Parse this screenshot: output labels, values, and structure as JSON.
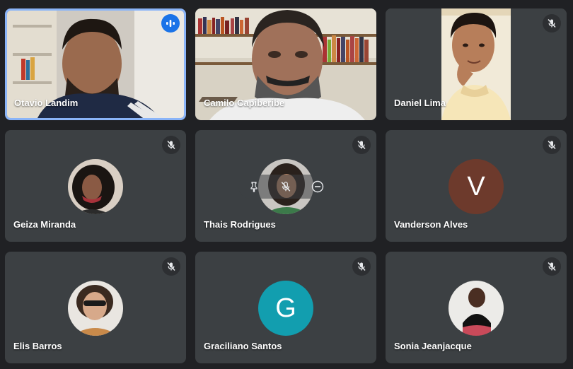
{
  "participants": [
    {
      "name": "Otavio Landim",
      "state": "speaking"
    },
    {
      "name": "Camilo Capiberibe",
      "state": "video"
    },
    {
      "name": "Daniel Lima",
      "state": "muted"
    },
    {
      "name": "Geiza Miranda",
      "state": "muted"
    },
    {
      "name": "Thais Rodrigues",
      "state": "muted"
    },
    {
      "name": "Vanderson Alves",
      "state": "muted",
      "initial": "V",
      "avatar_color": "#6d3a2c"
    },
    {
      "name": "Elis Barros",
      "state": "muted"
    },
    {
      "name": "Graciliano Santos",
      "state": "muted",
      "initial": "G",
      "avatar_color": "#129eaf"
    },
    {
      "name": "Sonia Jeanjacque",
      "state": "muted"
    }
  ],
  "icons": {
    "speaking": "audio-wave-icon",
    "muted": "mic-off-icon",
    "pin": "pin-icon",
    "remove": "remove-icon"
  },
  "colors": {
    "background": "#202124",
    "tile": "#3c4043",
    "active_border": "#8ab4f8",
    "speaking_badge": "#1a73e8"
  }
}
